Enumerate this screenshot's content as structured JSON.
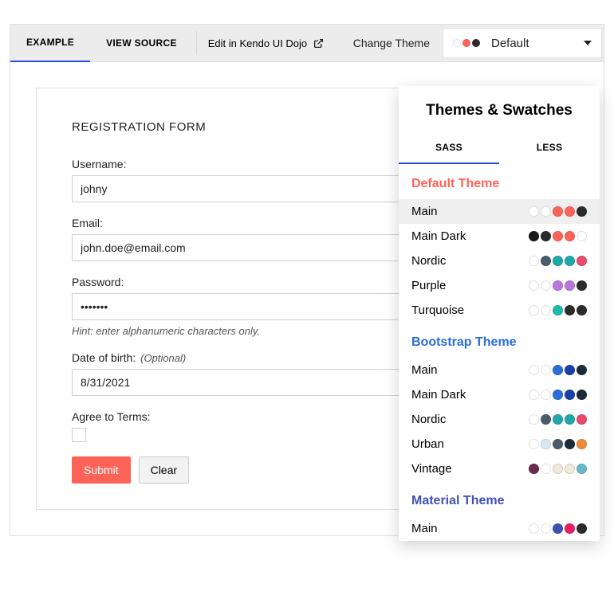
{
  "toolbar": {
    "tabs": [
      "EXAMPLE",
      "VIEW SOURCE"
    ],
    "dojo_label": "Edit in Kendo UI Dojo",
    "change_theme_label": "Change Theme",
    "theme_select": {
      "label": "Default",
      "dots": [
        "#ffffff",
        "#ff6358",
        "#2b2b2b"
      ]
    }
  },
  "form": {
    "title": "REGISTRATION FORM",
    "username_label": "Username:",
    "username_value": "johny",
    "email_label": "Email:",
    "email_value": "john.doe@email.com",
    "password_label": "Password:",
    "password_value": "•••••••",
    "password_hint": "Hint: enter alphanumeric characters only.",
    "dob_label": "Date of birth:",
    "dob_optional": "(Optional)",
    "dob_value": "8/31/2021",
    "agree_label": "Agree to Terms:",
    "submit_label": "Submit",
    "clear_label": "Clear"
  },
  "dropdown": {
    "header": "Themes & Swatches",
    "tabs": [
      "SASS",
      "LESS"
    ],
    "groups": [
      {
        "title": "Default Theme",
        "title_color": "#ff6358",
        "swatches": [
          {
            "name": "Main",
            "selected": true,
            "dots": [
              "#ffffff",
              "#ffffff",
              "#ff6358",
              "#ff6358",
              "#2b2b2b"
            ]
          },
          {
            "name": "Main Dark",
            "dots": [
              "#1a1a1a",
              "#2b2b2b",
              "#ff6358",
              "#ff6358",
              "#ffffff"
            ]
          },
          {
            "name": "Nordic",
            "dots": [
              "#ffffff",
              "#4a5d6b",
              "#1fa8a8",
              "#1fa8a8",
              "#e94b6e"
            ]
          },
          {
            "name": "Purple",
            "dots": [
              "#ffffff",
              "#ffffff",
              "#b877db",
              "#b877db",
              "#2b2b2b"
            ]
          },
          {
            "name": "Turquoise",
            "dots": [
              "#ffffff",
              "#ffffff",
              "#1fb9a8",
              "#2b2b2b",
              "#2b2b2b"
            ]
          }
        ]
      },
      {
        "title": "Bootstrap Theme",
        "title_color": "#2a6ed8",
        "swatches": [
          {
            "name": "Main",
            "dots": [
              "#ffffff",
              "#ffffff",
              "#2a6ed8",
              "#1a3fa8",
              "#1c2b3a"
            ]
          },
          {
            "name": "Main Dark",
            "dots": [
              "#ffffff",
              "#ffffff",
              "#2a6ed8",
              "#1a3fa8",
              "#1c2b3a"
            ]
          },
          {
            "name": "Nordic",
            "dots": [
              "#ffffff",
              "#4a5d6b",
              "#1fa8a8",
              "#1fa8a8",
              "#e94b6e"
            ]
          },
          {
            "name": "Urban",
            "dots": [
              "#ffffff",
              "#d8e8f0",
              "#4a5d6b",
              "#1c2b3a",
              "#f08a3c"
            ]
          },
          {
            "name": "Vintage",
            "dots": [
              "#6b2b4a",
              "#ffffff",
              "#f0e8d8",
              "#f0e8d8",
              "#6bb8c8"
            ]
          }
        ]
      },
      {
        "title": "Material Theme",
        "title_color": "#3f51b5",
        "swatches": [
          {
            "name": "Main",
            "dots": [
              "#ffffff",
              "#ffffff",
              "#3f51b5",
              "#e91e63",
              "#2b2b2b"
            ]
          }
        ]
      }
    ]
  }
}
